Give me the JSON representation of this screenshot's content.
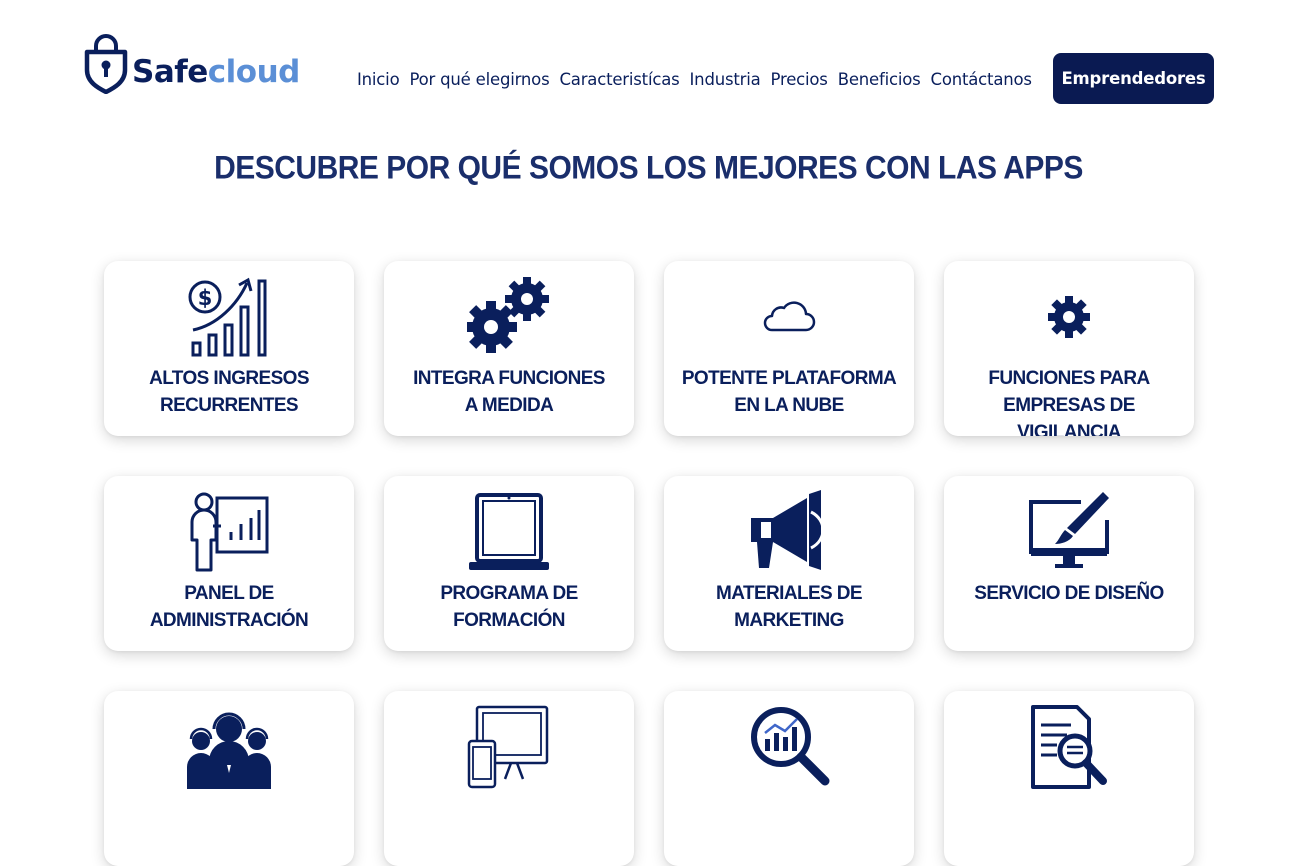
{
  "brand": {
    "name_part1": "Safe",
    "name_part2": "cloud"
  },
  "nav": {
    "items": [
      "Inicio",
      "Por qué elegirnos",
      "Caracteristícas",
      "Industria",
      "Precios",
      "Beneficios",
      "Contáctanos"
    ],
    "cta_label": "Emprendedores"
  },
  "main": {
    "headline": "DESCUBRE POR QUÉ SOMOS LOS MEJORES CON LAS APPS",
    "cards": [
      {
        "label": "ALTOS INGRESOS\nRECURRENTES",
        "icon": "revenue-growth-icon"
      },
      {
        "label": "INTEGRA FUNCIONES\nA MEDIDA",
        "icon": "gears-icon"
      },
      {
        "label": "POTENTE PLATAFORMA\nEN LA NUBE",
        "icon": "cloud-icon"
      },
      {
        "label": "FUNCIONES PARA\nEMPRESAS DE VIGILANCIA",
        "icon": "gear-icon"
      },
      {
        "label": "PANEL DE\nADMINISTRACIÓN",
        "icon": "presenter-chart-icon"
      },
      {
        "label": "PROGRAMA DE\nFORMACIÓN",
        "icon": "laptop-icon"
      },
      {
        "label": "MATERIALES DE\nMARKETING",
        "icon": "megaphone-icon"
      },
      {
        "label": "SERVICIO DE DISEÑO",
        "icon": "monitor-brush-icon"
      },
      {
        "label": "",
        "icon": "support-team-icon"
      },
      {
        "label": "",
        "icon": "devices-icon"
      },
      {
        "label": "",
        "icon": "analytics-search-icon"
      },
      {
        "label": "",
        "icon": "document-search-icon"
      }
    ]
  },
  "colors": {
    "navy": "#0a1f5c",
    "cta_bg": "#0a1a52",
    "brand_light": "#5b8fd6"
  }
}
